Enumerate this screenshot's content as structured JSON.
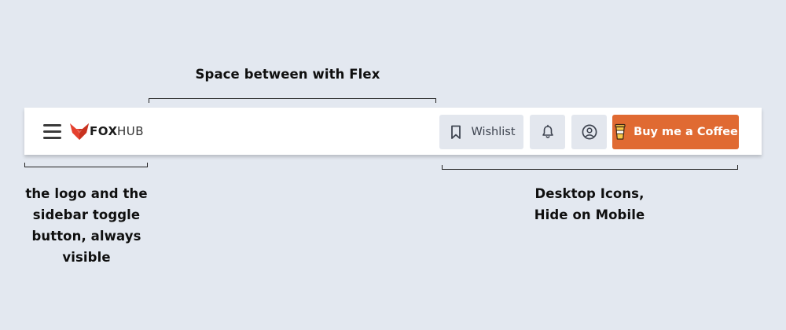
{
  "annotations": {
    "space_between": "Space between with Flex",
    "logo_note_lines": [
      "the logo and the",
      "sidebar toggle",
      "button, always",
      "visible"
    ],
    "desktop_note_lines": [
      "Desktop Icons,",
      "Hide on Mobile"
    ]
  },
  "navbar": {
    "logo": {
      "brand_bold": "FOX",
      "brand_light": "HUB",
      "icon": "fox-logo-icon"
    },
    "menu_icon": "hamburger-icon",
    "wishlist": {
      "label": "Wishlist",
      "icon": "bookmark-icon"
    },
    "notifications": {
      "icon": "bell-icon"
    },
    "account": {
      "icon": "user-circle-icon"
    },
    "coffee": {
      "label": "Buy me a Coffee",
      "icon": "coffee-cup-icon"
    }
  },
  "colors": {
    "background": "#e3e8f0",
    "navbar": "#ffffff",
    "icon_button": "#e3e7ee",
    "accent": "#e06a32",
    "logo_red": "#e5412f"
  }
}
